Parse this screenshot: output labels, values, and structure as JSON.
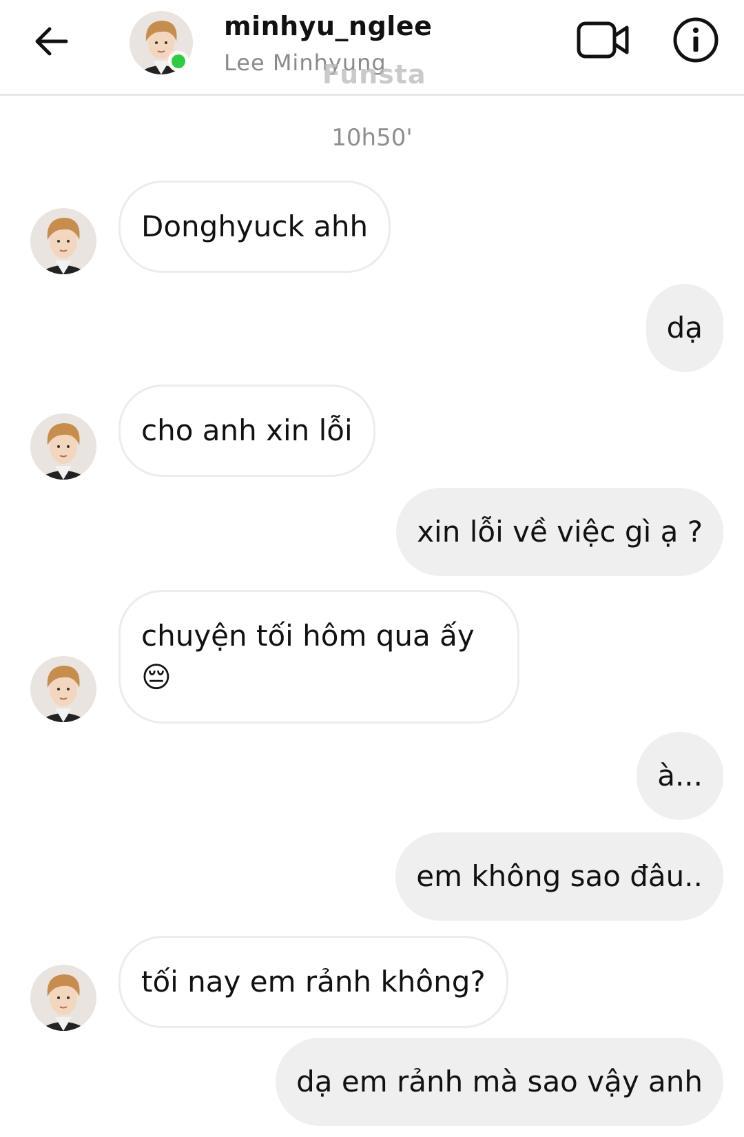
{
  "header": {
    "username": "minhyu_nglee",
    "real_name": "Lee Minhyung",
    "watermark": "Funsta",
    "online": true,
    "icons": [
      "back-arrow-icon",
      "video-call-icon",
      "info-icon"
    ]
  },
  "chat": {
    "timestamp": "10h50'",
    "messages": [
      {
        "from": "them",
        "text": "Donghyuck ahh"
      },
      {
        "from": "me",
        "text": "dạ"
      },
      {
        "from": "them",
        "text": "cho anh xin lỗi"
      },
      {
        "from": "me",
        "text": "xin lỗi về việc gì ạ ?"
      },
      {
        "from": "them",
        "text": "chuyện tối hôm qua ấy",
        "emoji": "😔"
      },
      {
        "from": "me",
        "text": "à..."
      },
      {
        "from": "me",
        "text": "em không sao đâu.."
      },
      {
        "from": "them",
        "text": "tối nay em rảnh không?"
      },
      {
        "from": "me",
        "text": "dạ em rảnh mà sao vậy anh"
      }
    ]
  },
  "colors": {
    "online": "#2ecc40",
    "outgoing_bubble": "#efefef",
    "incoming_border": "#ececec",
    "muted_text": "#8e8e8e"
  }
}
